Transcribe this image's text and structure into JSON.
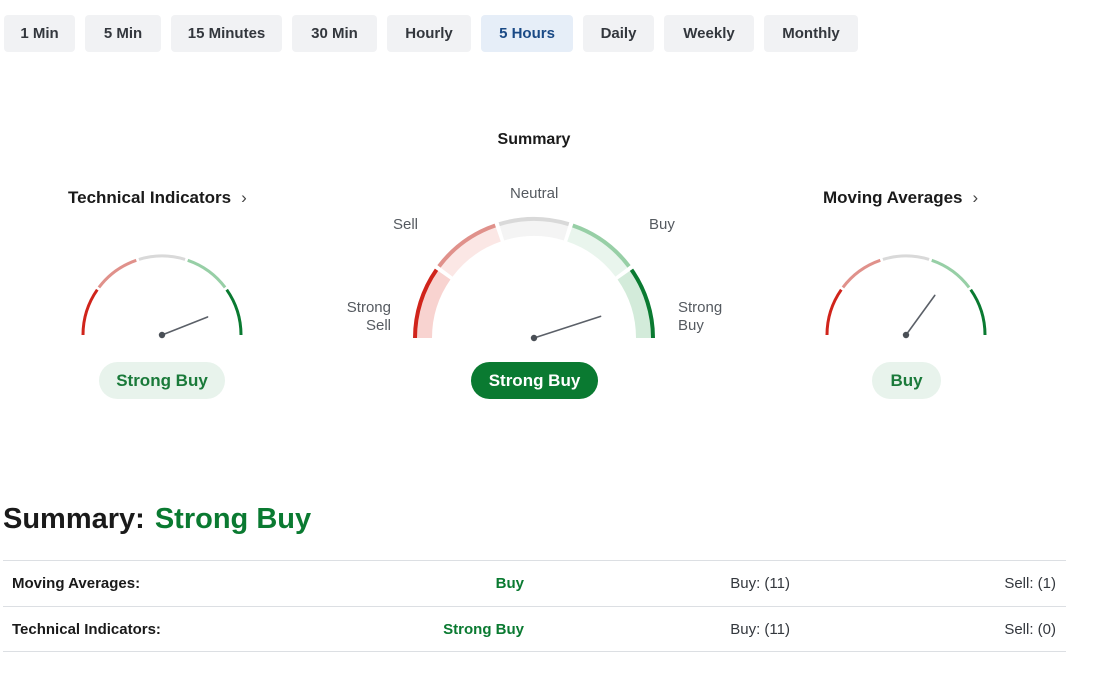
{
  "timeframes": [
    {
      "label": "1 Min",
      "active": false
    },
    {
      "label": "5 Min",
      "active": false
    },
    {
      "label": "15 Minutes",
      "active": false
    },
    {
      "label": "30 Min",
      "active": false
    },
    {
      "label": "Hourly",
      "active": false
    },
    {
      "label": "5 Hours",
      "active": true
    },
    {
      "label": "Daily",
      "active": false
    },
    {
      "label": "Weekly",
      "active": false
    },
    {
      "label": "Monthly",
      "active": false
    }
  ],
  "gauges": {
    "summary_caption": "Summary",
    "technical": {
      "title": "Technical Indicators",
      "verdict": "Strong Buy",
      "needle_level": 0.88
    },
    "summary": {
      "verdict": "Strong Buy",
      "needle_level": 0.9,
      "labels": {
        "strong_sell": [
          "Strong",
          "Sell"
        ],
        "sell": "Sell",
        "neutral": "Neutral",
        "buy": "Buy",
        "strong_buy": [
          "Strong",
          "Buy"
        ]
      }
    },
    "moving_averages": {
      "title": "Moving Averages",
      "verdict": "Buy",
      "needle_level": 0.7
    },
    "colors": {
      "strong_sell": "#d0241b",
      "sell": "#e0918b",
      "neutral": "#d9d9d9",
      "buy": "#97cfa6",
      "strong_buy": "#0a7a31"
    }
  },
  "summary": {
    "label": "Summary:",
    "verdict": "Strong Buy",
    "rows": [
      {
        "name": "Moving Averages:",
        "verdict": "Buy",
        "buy": "Buy: (11)",
        "sell": "Sell: (1)"
      },
      {
        "name": "Technical Indicators:",
        "verdict": "Strong Buy",
        "buy": "Buy: (11)",
        "sell": "Sell: (0)"
      }
    ]
  }
}
